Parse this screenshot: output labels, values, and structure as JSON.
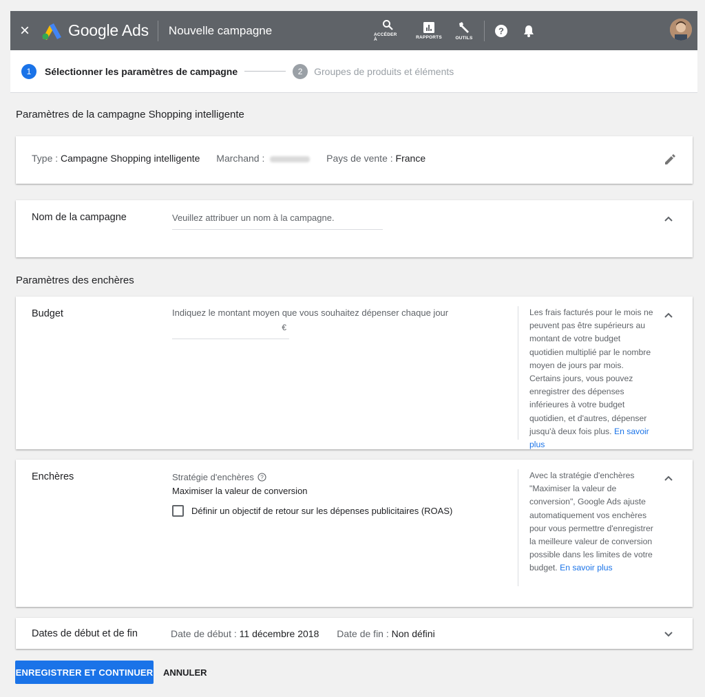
{
  "header": {
    "close_glyph": "×",
    "brand": "Google Ads",
    "campaign_title": "Nouvelle campagne",
    "nav": [
      {
        "label": "ACCÉDER À",
        "icon": "search-icon"
      },
      {
        "label": "RAPPORTS",
        "icon": "reports-icon"
      },
      {
        "label": "OUTILS",
        "icon": "wrench-icon"
      }
    ],
    "help_icon": "help-icon",
    "notifications_icon": "bell-icon",
    "header_color": "#5f6368"
  },
  "stepper": {
    "step1_number": "1",
    "step1_label": "Sélectionner les paramètres de campagne",
    "step2_number": "2",
    "step2_label": "Groupes de produits et éléments"
  },
  "campaign_settings": {
    "title": "Paramètres de la campagne Shopping intelligente",
    "type_label": "Type :",
    "type_value": "Campagne Shopping intelligente",
    "merchant_label": "Marchand :",
    "country_label": "Pays de vente :",
    "country_value": "France"
  },
  "campaign_name": {
    "label": "Nom de la campagne",
    "placeholder": "Veuillez attribuer un nom à la campagne."
  },
  "bidding_section": {
    "title": "Paramètres des enchères"
  },
  "budget": {
    "label": "Budget",
    "hint": "Indiquez le montant moyen que vous souhaitez dépenser chaque jour",
    "currency": "€",
    "side_text": "Les frais facturés pour le mois ne peuvent pas être supérieurs au montant de votre budget quotidien multiplié par le nombre moyen de jours par mois. Certains jours, vous pouvez enregistrer des dépenses inférieures à votre budget quotidien, et d'autres, dépenser jusqu'à deux fois plus.",
    "learn_more": "En savoir plus"
  },
  "bids": {
    "label": "Enchères",
    "strategy_label": "Stratégie d'enchères",
    "strategy_value": "Maximiser la valeur de conversion",
    "checkbox_label": "Définir un objectif de retour sur les dépenses publicitaires (ROAS)",
    "side_text": "Avec la stratégie d'enchères \"Maximiser la valeur de conversion\", Google Ads ajuste automatiquement vos enchères pour vous permettre d'enregistrer la meilleure valeur de conversion possible dans les limites de votre budget.",
    "learn_more": "En savoir plus"
  },
  "dates": {
    "label": "Dates de début et de fin",
    "start_label": "Date de début :",
    "start_value": "11 décembre 2018",
    "end_label": "Date de fin :",
    "end_value": "Non défini"
  },
  "actions": {
    "save_label": "ENREGISTRER ET CONTINUER",
    "cancel_label": "ANNULER",
    "primary_color": "#1a73e8"
  }
}
